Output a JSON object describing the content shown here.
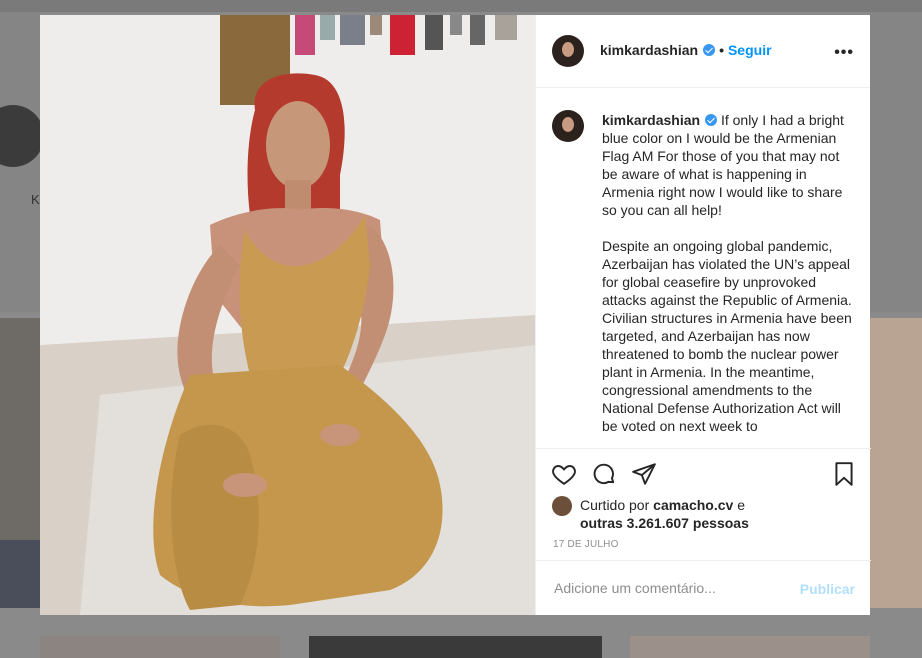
{
  "background": {
    "profile_initial": "K"
  },
  "post": {
    "username": "kimkardashian",
    "follow_label": "Seguir",
    "separator": "•",
    "more_label": "•••",
    "caption_paragraphs": [
      "If only I had a bright blue color on I would be the Armenian Flag AM For those of you that may not be aware of what is happening in Armenia right now I would like to share so you can all help!",
      "Despite an ongoing global pandemic, Azerbaijan has violated the UN’s appeal for global ceasefire by unprovoked attacks against the Republic of Armenia. Civilian structures in Armenia have been targeted, and Azerbaijan has now threatened to bomb the nuclear power plant in Armenia. In the meantime, congressional amendments to the National Defense Authorization Act will be voted on next week to"
    ],
    "likes": {
      "prefix": "Curtido por",
      "liker": "camacho.cv",
      "conjunction": "e",
      "others": "outras 3.261.607 pessoas"
    },
    "date": "17 DE JULHO",
    "comment_placeholder": "Adicione um comentário...",
    "publish_label": "Publicar"
  },
  "icons": [
    "heart-icon",
    "comment-icon",
    "share-icon",
    "bookmark-icon",
    "verified-badge-icon"
  ],
  "colors": {
    "link": "#0095f6",
    "verified": "#3897f0",
    "publish_disabled": "#b2dffc",
    "muted": "#8e8e8e",
    "text": "#262626"
  }
}
